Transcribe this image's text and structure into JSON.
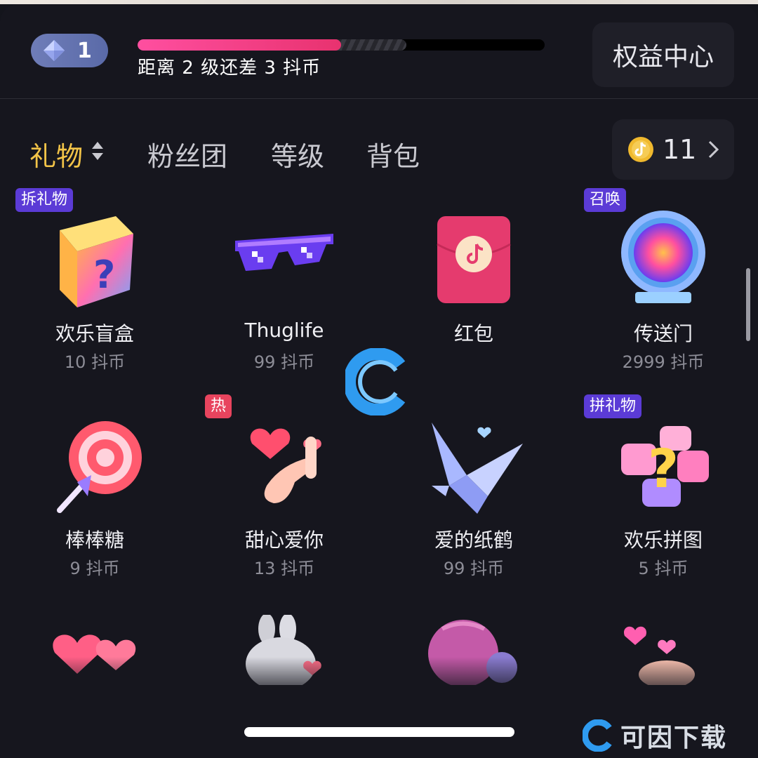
{
  "header": {
    "level": "1",
    "progress_fraction": 0.5,
    "progress_text": "距离 2 级还差 3 抖币",
    "benefit_button": "权益中心"
  },
  "tabs": [
    {
      "label": "礼物",
      "active": true
    },
    {
      "label": "粉丝团",
      "active": false
    },
    {
      "label": "等级",
      "active": false
    },
    {
      "label": "背包",
      "active": false
    }
  ],
  "balance": {
    "count": "11",
    "icon": "douyin-coin-icon"
  },
  "gifts": [
    {
      "name": "欢乐盲盒",
      "price": "10 抖币",
      "tag": "拆礼物",
      "icon": "blind-box-icon"
    },
    {
      "name": "Thuglife",
      "price": "99 抖币",
      "tag": "",
      "icon": "pixel-sunglasses-icon"
    },
    {
      "name": "红包",
      "price": "",
      "tag": "",
      "icon": "red-envelope-icon"
    },
    {
      "name": "传送门",
      "price": "2999 抖币",
      "tag": "召唤",
      "icon": "portal-icon"
    },
    {
      "name": "棒棒糖",
      "price": "9 抖币",
      "tag": "",
      "icon": "lollipop-icon"
    },
    {
      "name": "甜心爱你",
      "price": "13 抖币",
      "tag": "热",
      "icon": "finger-heart-icon"
    },
    {
      "name": "爱的纸鹤",
      "price": "99 抖币",
      "tag": "",
      "icon": "paper-crane-icon"
    },
    {
      "name": "欢乐拼图",
      "price": "5 抖币",
      "tag": "拼礼物",
      "icon": "puzzle-icon"
    }
  ],
  "partial_row_icons": [
    "hearts-icon",
    "bunny-icon",
    "hot-air-balloon-icon",
    "heart-hand-icon"
  ],
  "watermark": {
    "text": "可因下载",
    "logo": "c-logo-icon"
  },
  "colors": {
    "background": "#16161e",
    "active_tab": "#f3c448",
    "progress": "#e8326f",
    "tag_purple": "#5b3bd6",
    "tag_hot": "#e8445e"
  }
}
